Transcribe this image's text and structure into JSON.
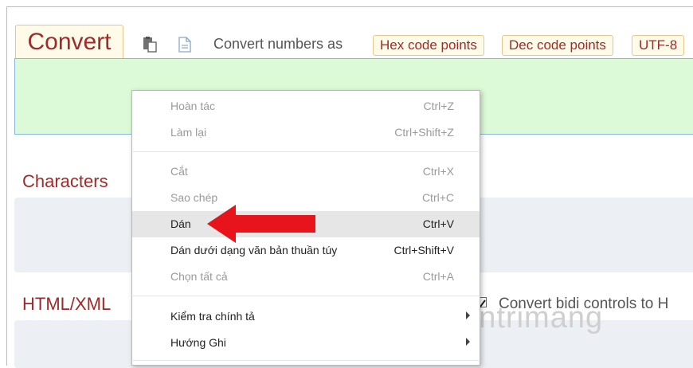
{
  "toolbar": {
    "convert_label": "Convert",
    "convert_as_label": "Convert numbers as",
    "chips": [
      "Hex code points",
      "Dec code points",
      "UTF-8"
    ]
  },
  "sections": {
    "characters": "Characters",
    "html_xml": "HTML/XML",
    "bidi_label": "Convert bidi controls to H"
  },
  "context_menu": {
    "items": [
      {
        "label": "Hoàn tác",
        "shortcut": "Ctrl+Z",
        "enabled": false
      },
      {
        "label": "Làm lại",
        "shortcut": "Ctrl+Shift+Z",
        "enabled": false
      },
      {
        "label": "Cắt",
        "shortcut": "Ctrl+X",
        "enabled": false
      },
      {
        "label": "Sao chép",
        "shortcut": "Ctrl+C",
        "enabled": false
      },
      {
        "label": "Dán",
        "shortcut": "Ctrl+V",
        "enabled": true,
        "highlighted": true
      },
      {
        "label": "Dán dưới dạng văn bản thuần túy",
        "shortcut": "Ctrl+Shift+V",
        "enabled": true
      },
      {
        "label": "Chọn tất cả",
        "shortcut": "Ctrl+A",
        "enabled": false
      },
      {
        "label": "Kiểm tra chính tả",
        "submenu": true,
        "enabled": true
      },
      {
        "label": "Hướng Ghi",
        "submenu": true,
        "enabled": true
      }
    ]
  },
  "watermark": {
    "text": "uantrimang"
  },
  "colors": {
    "accent": "#9e2a2a",
    "chip_bg": "#fffbe8",
    "chip_border": "#e3c78f",
    "input_bg": "#dcfad7",
    "input_border": "#86b8e0",
    "panel_bg": "#eceff3",
    "arrow": "#e8141b"
  },
  "icons": [
    "paste-icon",
    "document-icon",
    "red-arrow-icon",
    "chevron-right-icon"
  ]
}
